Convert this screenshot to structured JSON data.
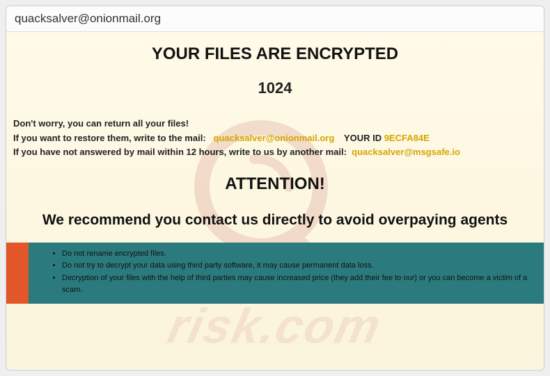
{
  "window": {
    "title": "quacksalver@onionmail.org"
  },
  "headings": {
    "main": "YOUR FILES ARE ENCRYPTED",
    "number": "1024",
    "attention": "ATTENTION!",
    "recommend": "We recommend you contact us directly to avoid overpaying agents"
  },
  "info": {
    "line1": "Don't worry, you can return all your files!",
    "line2_prefix": "If you want to restore them, write to the mail:",
    "email1": "quacksalver@onionmail.org",
    "yourid_label": "YOUR ID",
    "yourid_value": "9ECFA84E",
    "line3_prefix": "If you have not answered by mail within 12 hours, write to us by another mail:",
    "email2": "quacksalver@msgsafe.io"
  },
  "notices": {
    "items": [
      "Do not rename encrypted files.",
      "Do not try to decrypt your data using third party software, it may cause permanent data loss.",
      "Decryption of your files with the help of third parties may cause increased price (they add their fee to our) or you can become a victim of a scam."
    ]
  },
  "watermark": {
    "text": "risk.com"
  }
}
